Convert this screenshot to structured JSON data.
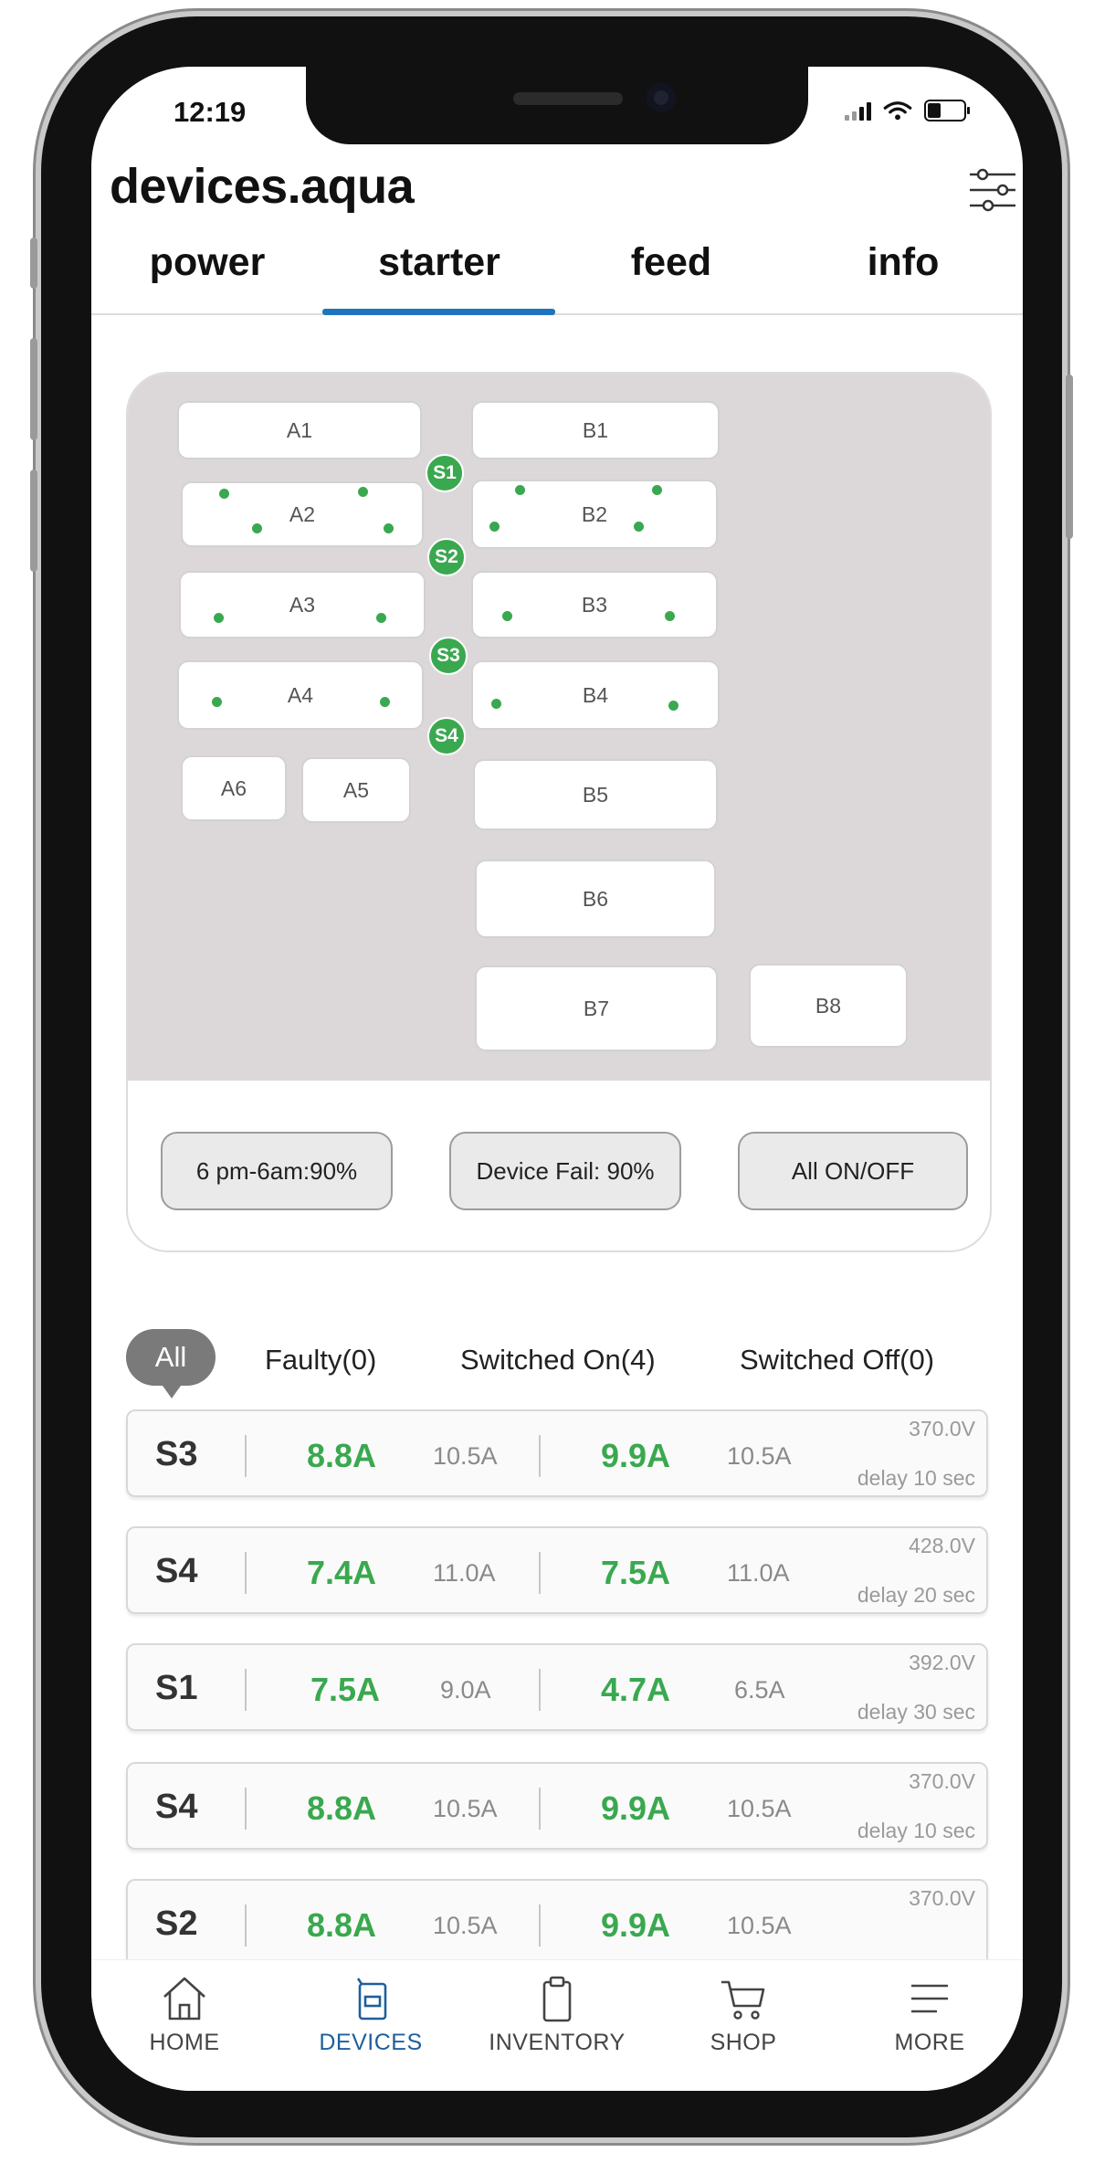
{
  "status_bar": {
    "time": "12:19"
  },
  "header": {
    "title": "devices.aqua",
    "settings_icon": "sliders-icon"
  },
  "tabs": [
    {
      "label": "power"
    },
    {
      "label": "starter",
      "active": true
    },
    {
      "label": "feed"
    },
    {
      "label": "info"
    }
  ],
  "map": {
    "tanks": {
      "A1": "A1",
      "A2": "A2",
      "A3": "A3",
      "A4": "A4",
      "A5": "A5",
      "A6": "A6",
      "B1": "B1",
      "B2": "B2",
      "B3": "B3",
      "B4": "B4",
      "B5": "B5",
      "B6": "B6",
      "B7": "B7",
      "B8": "B8"
    },
    "starters": {
      "S1": "S1",
      "S2": "S2",
      "S3": "S3",
      "S4": "S4"
    },
    "status_color": "#3aa84f",
    "buttons": {
      "schedule": "6 pm-6am:90%",
      "device_fail": "Device Fail: 90%",
      "all_on_off": "All ON/OFF"
    }
  },
  "filters": {
    "all": "All",
    "faulty": "Faulty(0)",
    "switched_on": "Switched On(4)",
    "switched_off": "Switched Off(0)"
  },
  "starters": [
    {
      "name": "S3",
      "current1": "8.8A",
      "max1": "10.5A",
      "current2": "9.9A",
      "max2": "10.5A",
      "voltage": "370.0V",
      "delay": "delay 10 sec"
    },
    {
      "name": "S4",
      "current1": "7.4A",
      "max1": "11.0A",
      "current2": "7.5A",
      "max2": "11.0A",
      "voltage": "428.0V",
      "delay": "delay 20 sec"
    },
    {
      "name": "S1",
      "current1": "7.5A",
      "max1": "9.0A",
      "current2": "4.7A",
      "max2": "6.5A",
      "voltage": "392.0V",
      "delay": "delay 30 sec"
    },
    {
      "name": "S4",
      "current1": "8.8A",
      "max1": "10.5A",
      "current2": "9.9A",
      "max2": "10.5A",
      "voltage": "370.0V",
      "delay": "delay 10 sec"
    },
    {
      "name": "S2",
      "current1": "8.8A",
      "max1": "10.5A",
      "current2": "9.9A",
      "max2": "10.5A",
      "voltage": "370.0V",
      "delay": ""
    }
  ],
  "bottom_nav": [
    {
      "label": "HOME",
      "icon": "home-icon"
    },
    {
      "label": "DEVICES",
      "icon": "devices-icon",
      "active": true
    },
    {
      "label": "INVENTORY",
      "icon": "clipboard-icon"
    },
    {
      "label": "SHOP",
      "icon": "cart-icon"
    },
    {
      "label": "MORE",
      "icon": "menu-icon"
    }
  ],
  "colors": {
    "accent": "#1f75bd",
    "active_nav": "#1f5f9c",
    "ok_green": "#3aa84f",
    "map_bg": "#dcd8d9"
  }
}
